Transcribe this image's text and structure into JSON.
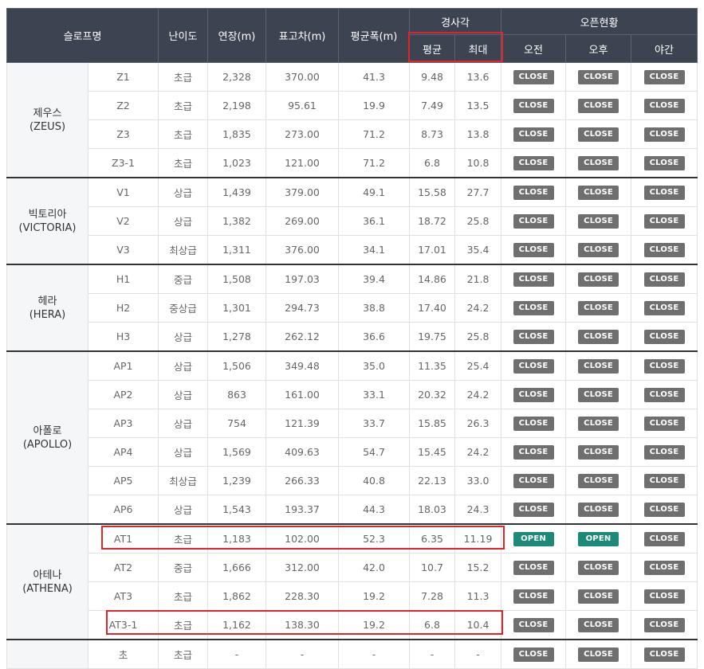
{
  "header": {
    "slope": "슬로프명",
    "difficulty": "난이도",
    "length": "연장(m)",
    "elevation": "표고차(m)",
    "avg_width": "평균폭(m)",
    "incline": "경사각",
    "incline_avg": "평균",
    "incline_max": "최대",
    "open_status": "오픈현황",
    "morning": "오전",
    "afternoon": "오후",
    "night": "야간"
  },
  "groups": [
    {
      "name": "제우스",
      "name_en": "(ZEUS)",
      "rows": [
        {
          "code": "Z1",
          "level": "초급",
          "length": "2,328",
          "elev": "370.00",
          "width": "41.3",
          "avg": "9.48",
          "max": "13.6",
          "am": "CLOSE",
          "pm": "CLOSE",
          "night": "CLOSE"
        },
        {
          "code": "Z2",
          "level": "초급",
          "length": "2,198",
          "elev": "95.61",
          "width": "19.9",
          "avg": "7.49",
          "max": "13.5",
          "am": "CLOSE",
          "pm": "CLOSE",
          "night": "CLOSE"
        },
        {
          "code": "Z3",
          "level": "초급",
          "length": "1,835",
          "elev": "273.00",
          "width": "71.2",
          "avg": "8.73",
          "max": "13.8",
          "am": "CLOSE",
          "pm": "CLOSE",
          "night": "CLOSE"
        },
        {
          "code": "Z3-1",
          "level": "초급",
          "length": "1,023",
          "elev": "121.00",
          "width": "71.2",
          "avg": "6.8",
          "max": "10.8",
          "am": "CLOSE",
          "pm": "CLOSE",
          "night": "CLOSE"
        }
      ]
    },
    {
      "name": "빅토리아",
      "name_en": "(VICTORIA)",
      "rows": [
        {
          "code": "V1",
          "level": "상급",
          "length": "1,439",
          "elev": "379.00",
          "width": "49.1",
          "avg": "15.58",
          "max": "27.7",
          "am": "CLOSE",
          "pm": "CLOSE",
          "night": "CLOSE"
        },
        {
          "code": "V2",
          "level": "상급",
          "length": "1,382",
          "elev": "269.00",
          "width": "36.1",
          "avg": "18.72",
          "max": "25.8",
          "am": "CLOSE",
          "pm": "CLOSE",
          "night": "CLOSE"
        },
        {
          "code": "V3",
          "level": "최상급",
          "length": "1,311",
          "elev": "376.00",
          "width": "34.1",
          "avg": "17.01",
          "max": "35.4",
          "am": "CLOSE",
          "pm": "CLOSE",
          "night": "CLOSE"
        }
      ]
    },
    {
      "name": "헤라",
      "name_en": "(HERA)",
      "rows": [
        {
          "code": "H1",
          "level": "중급",
          "length": "1,508",
          "elev": "197.03",
          "width": "39.4",
          "avg": "14.86",
          "max": "21.8",
          "am": "CLOSE",
          "pm": "CLOSE",
          "night": "CLOSE"
        },
        {
          "code": "H2",
          "level": "중상급",
          "length": "1,301",
          "elev": "294.73",
          "width": "38.8",
          "avg": "17.40",
          "max": "24.2",
          "am": "CLOSE",
          "pm": "CLOSE",
          "night": "CLOSE"
        },
        {
          "code": "H3",
          "level": "상급",
          "length": "1,278",
          "elev": "262.12",
          "width": "36.6",
          "avg": "19.75",
          "max": "25.8",
          "am": "CLOSE",
          "pm": "CLOSE",
          "night": "CLOSE"
        }
      ]
    },
    {
      "name": "아폴로",
      "name_en": "(APOLLO)",
      "rows": [
        {
          "code": "AP1",
          "level": "상급",
          "length": "1,506",
          "elev": "349.48",
          "width": "35.0",
          "avg": "11.35",
          "max": "25.4",
          "am": "CLOSE",
          "pm": "CLOSE",
          "night": "CLOSE"
        },
        {
          "code": "AP2",
          "level": "상급",
          "length": "863",
          "elev": "161.00",
          "width": "33.1",
          "avg": "20.32",
          "max": "24.2",
          "am": "CLOSE",
          "pm": "CLOSE",
          "night": "CLOSE"
        },
        {
          "code": "AP3",
          "level": "상급",
          "length": "754",
          "elev": "121.39",
          "width": "33.7",
          "avg": "15.85",
          "max": "26.3",
          "am": "CLOSE",
          "pm": "CLOSE",
          "night": "CLOSE"
        },
        {
          "code": "AP4",
          "level": "상급",
          "length": "1,569",
          "elev": "409.63",
          "width": "54.7",
          "avg": "15.45",
          "max": "24.2",
          "am": "CLOSE",
          "pm": "CLOSE",
          "night": "CLOSE"
        },
        {
          "code": "AP5",
          "level": "최상급",
          "length": "1,239",
          "elev": "266.33",
          "width": "40.8",
          "avg": "22.13",
          "max": "33.0",
          "am": "CLOSE",
          "pm": "CLOSE",
          "night": "CLOSE"
        },
        {
          "code": "AP6",
          "level": "상급",
          "length": "1,543",
          "elev": "193.37",
          "width": "44.3",
          "avg": "18.03",
          "max": "24.3",
          "am": "CLOSE",
          "pm": "CLOSE",
          "night": "CLOSE"
        }
      ]
    },
    {
      "name": "아테나",
      "name_en": "(ATHENA)",
      "rows": [
        {
          "code": "AT1",
          "level": "초급",
          "length": "1,183",
          "elev": "102.00",
          "width": "52.3",
          "avg": "6.35",
          "max": "11.19",
          "am": "OPEN",
          "pm": "OPEN",
          "night": "CLOSE"
        },
        {
          "code": "AT2",
          "level": "중급",
          "length": "1,666",
          "elev": "312.00",
          "width": "42.0",
          "avg": "10.7",
          "max": "15.2",
          "am": "CLOSE",
          "pm": "CLOSE",
          "night": "CLOSE"
        },
        {
          "code": "AT3",
          "level": "초급",
          "length": "1,862",
          "elev": "228.30",
          "width": "19.2",
          "avg": "7.28",
          "max": "11.3",
          "am": "CLOSE",
          "pm": "CLOSE",
          "night": "CLOSE"
        },
        {
          "code": "AT3-1",
          "level": "초급",
          "length": "1,162",
          "elev": "138.30",
          "width": "19.2",
          "avg": "6.8",
          "max": "10.4",
          "am": "CLOSE",
          "pm": "CLOSE",
          "night": "CLOSE"
        }
      ]
    },
    {
      "name": "",
      "name_en": "",
      "rows": [
        {
          "code": "초",
          "level": "초급",
          "length": "-",
          "elev": "-",
          "width": "-",
          "avg": "-",
          "max": "-",
          "am": "CLOSE",
          "pm": "CLOSE",
          "night": "CLOSE"
        }
      ]
    }
  ],
  "colors": {
    "header_bg": "#3d4451",
    "close_btn": "#6f6f6f",
    "open_btn": "#1b8a78",
    "highlight": "#e0242b"
  }
}
